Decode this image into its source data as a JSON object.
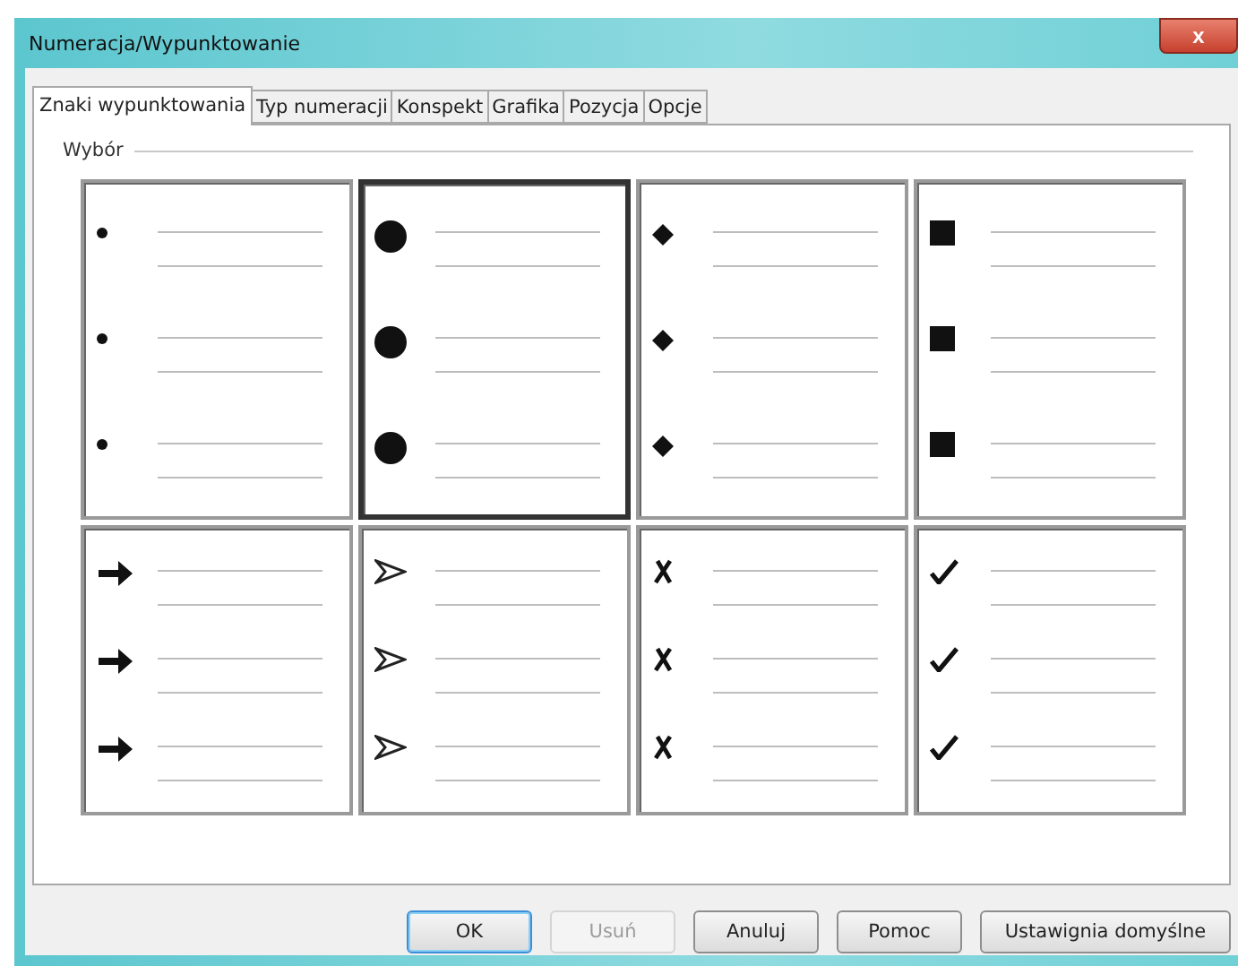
{
  "window": {
    "title": "Numeracja/Wypunktowanie",
    "close": "x"
  },
  "tabs": [
    {
      "label": "Znaki wypunktowania",
      "selected": true
    },
    {
      "label": "Typ numeracji",
      "selected": false
    },
    {
      "label": "Konspekt",
      "selected": false
    },
    {
      "label": "Grafika",
      "selected": false
    },
    {
      "label": "Pozycja",
      "selected": false
    },
    {
      "label": "Opcje",
      "selected": false
    }
  ],
  "group": {
    "title": "Wybór"
  },
  "cells": [
    {
      "kind": "small-dot",
      "selected": false
    },
    {
      "kind": "big-dot",
      "selected": true
    },
    {
      "kind": "diamond",
      "selected": false
    },
    {
      "kind": "square",
      "selected": false
    },
    {
      "kind": "arrow",
      "selected": false
    },
    {
      "kind": "arrowhead",
      "selected": false
    },
    {
      "kind": "cross",
      "selected": false
    },
    {
      "kind": "check",
      "selected": false
    }
  ],
  "buttons": [
    {
      "label": "OK",
      "disabled": false,
      "default": true
    },
    {
      "label": "Usuń",
      "disabled": true,
      "default": false
    },
    {
      "label": "Anuluj",
      "disabled": false,
      "default": false
    },
    {
      "label": "Pomoc",
      "disabled": false,
      "default": false
    },
    {
      "label": "Ustawignia domyślne",
      "disabled": false,
      "default": false
    }
  ]
}
